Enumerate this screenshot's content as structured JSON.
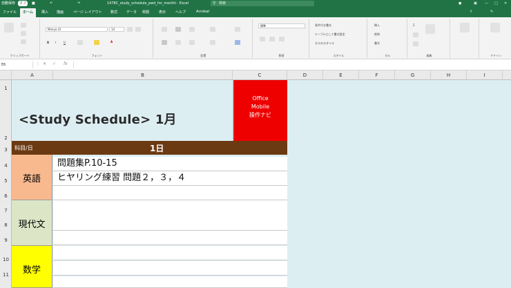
{
  "titlebar": {
    "autosave": "自動保存",
    "autosave_state": "オフ",
    "filename": "1478C_study_schedule_pwd_for_monthl - Excel",
    "search_placeholder": "検索"
  },
  "tabs": [
    "ファイル",
    "ホーム",
    "挿入",
    "描画",
    "ページ レイアウト",
    "数式",
    "データ",
    "校閲",
    "表示",
    "ヘルプ",
    "Acrobat"
  ],
  "ribbon": {
    "font_name": "Meiryo UI",
    "font_size": "14",
    "number_format": "標準",
    "groups": [
      "クリップボード",
      "フォント",
      "配置",
      "数値",
      "スタイル",
      "セル",
      "編集",
      "アドイン"
    ],
    "cond_format": "条件付き書式",
    "table_format": "テーブルとして書式設定",
    "cell_style": "セルのスタイル",
    "insert": "挿入",
    "delete": "削除",
    "format": "書式"
  },
  "formula_bar": {
    "name_box": "E6",
    "fx": "fx",
    "value": ""
  },
  "columns": [
    "A",
    "B",
    "C",
    "D",
    "E",
    "F",
    "G",
    "H",
    "I"
  ],
  "rows": [
    "1",
    "2",
    "3",
    "4",
    "5",
    "6",
    "7",
    "8",
    "9",
    "10",
    "11"
  ],
  "sheet": {
    "title": "<Study Schedule> 1月",
    "office_note": [
      "Office",
      "Mobile",
      "操作ナビ"
    ],
    "subject_header": "科目/日",
    "day_header": "1日",
    "subjects": [
      {
        "name": "英語",
        "color": "#f8b98f"
      },
      {
        "name": "現代文",
        "color": "#dce6c6"
      },
      {
        "name": "数学",
        "color": "#ffff00"
      }
    ],
    "tasks": [
      "問題集P.10-15",
      "ヒヤリング練習 問題２，３，４",
      "",
      "",
      "",
      "",
      ""
    ]
  }
}
